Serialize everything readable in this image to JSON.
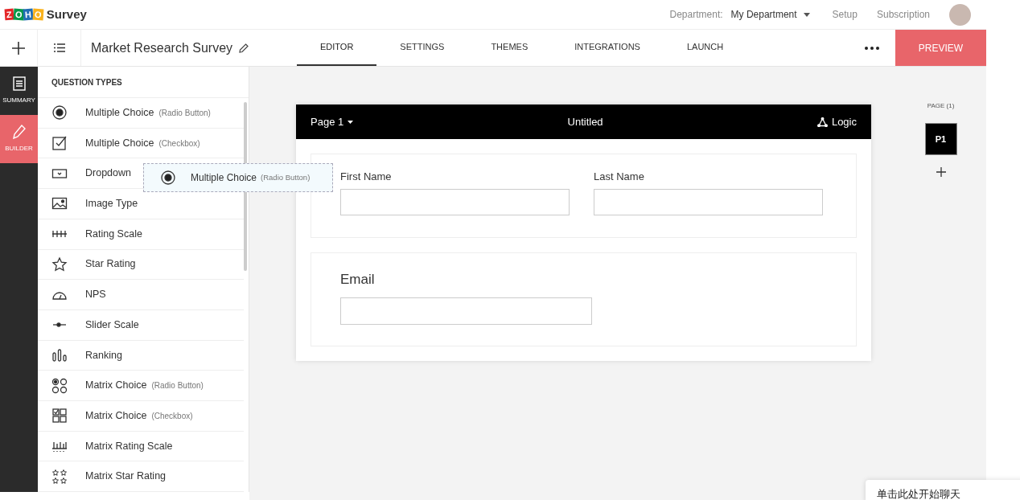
{
  "header": {
    "logo": "ZOHO",
    "product": "Survey",
    "department_label": "Department:",
    "department_value": "My Department",
    "links": [
      "Setup",
      "Subscription"
    ]
  },
  "toolbar": {
    "survey_title": "Market Research Survey",
    "tabs": [
      {
        "label": "EDITOR",
        "selected": true
      },
      {
        "label": "SETTINGS",
        "selected": false
      },
      {
        "label": "THEMES",
        "selected": false
      },
      {
        "label": "INTEGRATIONS",
        "selected": false
      },
      {
        "label": "LAUNCH",
        "selected": false
      }
    ],
    "preview": "PREVIEW"
  },
  "rail": [
    {
      "label": "SUMMARY",
      "kind": "summary",
      "selected": false
    },
    {
      "label": "BUILDER",
      "kind": "builder",
      "selected": true
    }
  ],
  "question_types": {
    "heading": "QUESTION TYPES",
    "items": [
      {
        "label": "Multiple Choice",
        "note": "(Radio Button)",
        "kind": "radio"
      },
      {
        "label": "Multiple Choice",
        "note": "(Checkbox)",
        "kind": "checkbox"
      },
      {
        "label": "Dropdown",
        "kind": "dropdown"
      },
      {
        "label": "Image Type",
        "kind": "image"
      },
      {
        "label": "Rating Scale",
        "kind": "rating"
      },
      {
        "label": "Star Rating",
        "kind": "star"
      },
      {
        "label": "NPS",
        "kind": "nps"
      },
      {
        "label": "Slider Scale",
        "kind": "slider"
      },
      {
        "label": "Ranking",
        "kind": "ranking"
      },
      {
        "label": "Matrix Choice",
        "note": "(Radio Button)",
        "kind": "matrix_radio"
      },
      {
        "label": "Matrix Choice",
        "note": "(Checkbox)",
        "kind": "matrix_checkbox"
      },
      {
        "label": "Matrix Rating Scale",
        "kind": "matrix_rating"
      },
      {
        "label": "Matrix Star Rating",
        "kind": "matrix_star"
      }
    ]
  },
  "drag_item": {
    "label": "Multiple Choice",
    "note": "(Radio Button)",
    "kind": "radio"
  },
  "form": {
    "page": "Page 1",
    "title": "Untitled",
    "logic": "Logic",
    "fields": [
      {
        "label": "First Name"
      },
      {
        "label": "Last Name"
      }
    ],
    "email": {
      "label": "Email"
    }
  },
  "pages": {
    "heading": "PAGE (1)",
    "items": [
      {
        "label": "P1",
        "selected": true
      }
    ]
  },
  "chat": {
    "text": "单击此处开始聊天"
  }
}
